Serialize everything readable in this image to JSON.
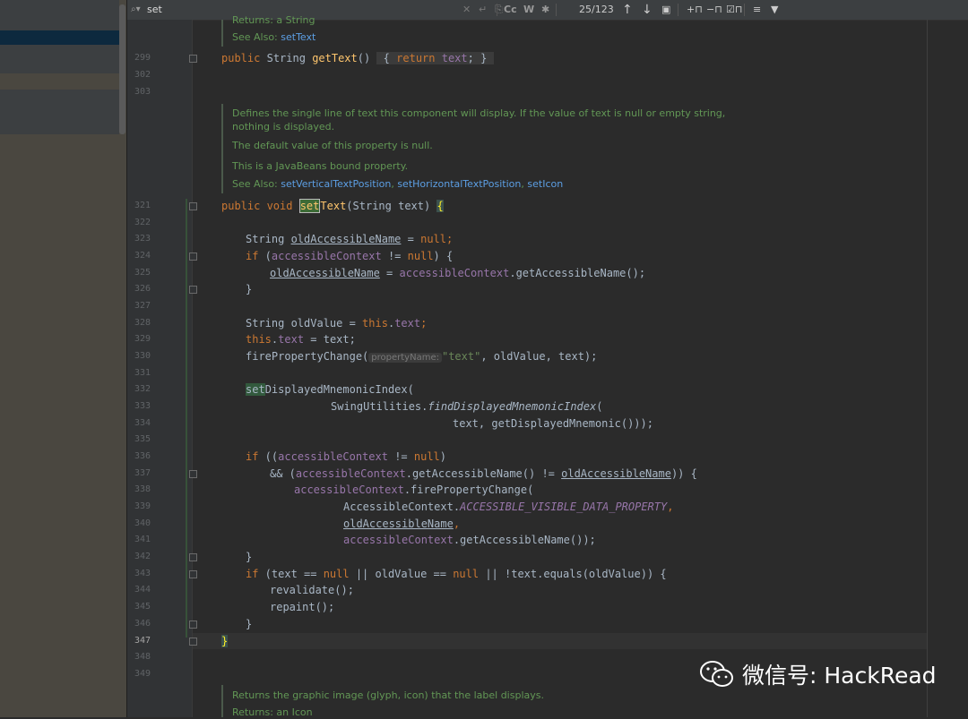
{
  "search": {
    "query": "set",
    "match_case": "Cc",
    "words": "W",
    "count": "25/123"
  },
  "line_numbers": [
    "299",
    "302",
    "303",
    "321",
    "322",
    "323",
    "324",
    "325",
    "326",
    "327",
    "328",
    "329",
    "330",
    "331",
    "332",
    "333",
    "334",
    "335",
    "336",
    "337",
    "338",
    "339",
    "340",
    "341",
    "342",
    "343",
    "344",
    "345",
    "346",
    "347",
    "348",
    "349"
  ],
  "doc_top": {
    "returns": "Returns:  a String",
    "see_label": "See Also: ",
    "see_link": "setText"
  },
  "code_299": {
    "kw": "public",
    "type": "String",
    "method": "getText",
    "body_kw": "return",
    "body_field": "text"
  },
  "doc_mid": {
    "line1": "Defines the single line of text this component will display. If the value of text is null or empty string,",
    "line2": "nothing is displayed.",
    "line3": "The default value of this property is null.",
    "line4": "This is a JavaBeans bound property.",
    "see_label": "See Also: ",
    "link1": "setVerticalTextPosition",
    "link2": "setHorizontalTextPosition",
    "link3": "setIcon"
  },
  "code": {
    "l321_a": "public void ",
    "l321_m": "set",
    "l321_b": "Text",
    "l321_c": "(String text) ",
    "l323_a": "String ",
    "l323_v": "oldAccessibleName",
    "l323_b": " = ",
    "l323_c": "null",
    "l323_d": ";",
    "l324_a": "if",
    "l324_b": " (",
    "l324_f": "accessibleContext",
    "l324_c": " != ",
    "l324_d": "null",
    "l324_e": ") {",
    "l325_v": "oldAccessibleName",
    "l325_b": " = ",
    "l325_f": "accessibleContext",
    "l325_c": ".getAccessibleName();",
    "l326": "}",
    "l328_a": "String oldValue = ",
    "l328_k": "this",
    "l328_b": ".",
    "l328_f": "text",
    "l328_c": ";",
    "l329_k": "this",
    "l329_b": ".",
    "l329_f": "text",
    "l329_c": " = text;",
    "l330_a": "firePropertyChange(",
    "l330_h": "propertyName:",
    "l330_s": "\"text\"",
    "l330_c": ", oldValue, text);",
    "l332_m": "set",
    "l332_a": "DisplayedMnemonicIndex(",
    "l333_a": "SwingUtilities.",
    "l333_i": "findDisplayedMnemonicIndex",
    "l333_b": "(",
    "l334": "text, getDisplayedMnemonic()));",
    "l336_a": "if",
    "l336_b": " ((",
    "l336_f": "accessibleContext",
    "l336_c": " != ",
    "l336_d": "null",
    "l336_e": ")",
    "l337_a": "&& (",
    "l337_f": "accessibleContext",
    "l337_b": ".getAccessibleName() != ",
    "l337_v": "oldAccessibleName",
    "l337_c": ")) {",
    "l338_f": "accessibleContext",
    "l338_a": ".firePropertyChange(",
    "l339_a": "AccessibleContext.",
    "l339_i": "ACCESSIBLE_VISIBLE_DATA_PROPERTY",
    "l339_b": ",",
    "l340_v": "oldAccessibleName",
    "l340_b": ",",
    "l341_f": "accessibleContext",
    "l341_a": ".getAccessibleName());",
    "l342": "}",
    "l343_a": "if",
    "l343_b": " (text == ",
    "l343_d": "null",
    "l343_c": " || oldValue == ",
    "l343_e": "null",
    "l343_g": " || !text.equals(oldValue)) {",
    "l344": "revalidate();",
    "l345": "repaint();",
    "l346": "}",
    "l347": "}"
  },
  "doc_bottom": {
    "line1": "Returns the graphic image (glyph, icon) that the label displays.",
    "returns": "Returns:  an Icon"
  },
  "watermark": {
    "text": "微信号: HackRead"
  }
}
